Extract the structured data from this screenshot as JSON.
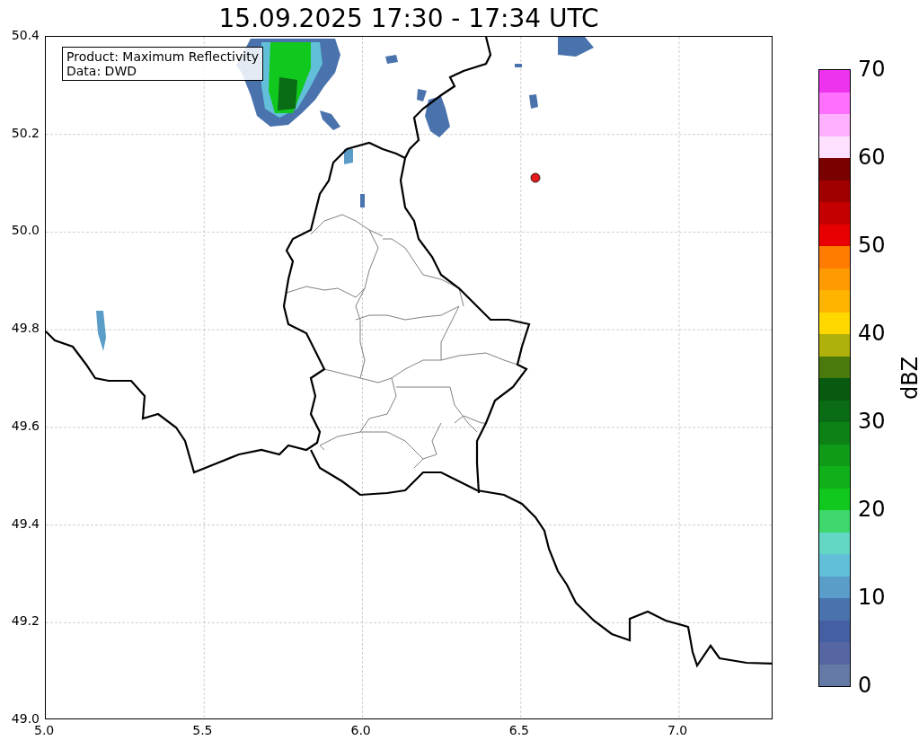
{
  "title": "15.09.2025 17:30 - 17:34 UTC",
  "map": {
    "annotation": [
      "Product: Maximum Reflectivity",
      "Data: DWD"
    ],
    "xticks": [
      "5.0",
      "5.5",
      "6.0",
      "6.5",
      "7.0"
    ],
    "yticks": [
      "50.4",
      "50.2",
      "50.0",
      "49.8",
      "49.6",
      "49.4",
      "49.2",
      "49.0"
    ]
  },
  "colorbar": {
    "label": "dBZ",
    "ticks": [
      "70",
      "60",
      "50",
      "40",
      "30",
      "20",
      "10",
      "0"
    ],
    "bands": [
      {
        "color": "#6479a6"
      },
      {
        "color": "#5566a3"
      },
      {
        "color": "#4460a3"
      },
      {
        "color": "#4a73ad"
      },
      {
        "color": "#5a9dc8"
      },
      {
        "color": "#62bfd9"
      },
      {
        "color": "#64d6c4"
      },
      {
        "color": "#3ed86d"
      },
      {
        "color": "#10c81e"
      },
      {
        "color": "#0fb01a"
      },
      {
        "color": "#0f9a18"
      },
      {
        "color": "#0c8216"
      },
      {
        "color": "#0a6c14"
      },
      {
        "color": "#085a10"
      },
      {
        "color": "#4a7a0c"
      },
      {
        "color": "#b0b00a"
      },
      {
        "color": "#ffd800"
      },
      {
        "color": "#ffb400"
      },
      {
        "color": "#ff9a00"
      },
      {
        "color": "#ff7c00"
      },
      {
        "color": "#e80000"
      },
      {
        "color": "#c40000"
      },
      {
        "color": "#a00000"
      },
      {
        "color": "#7a0000"
      },
      {
        "color": "#ffe0ff"
      },
      {
        "color": "#ffb0ff"
      },
      {
        "color": "#ff70ff"
      },
      {
        "color": "#ee33ee"
      }
    ]
  }
}
